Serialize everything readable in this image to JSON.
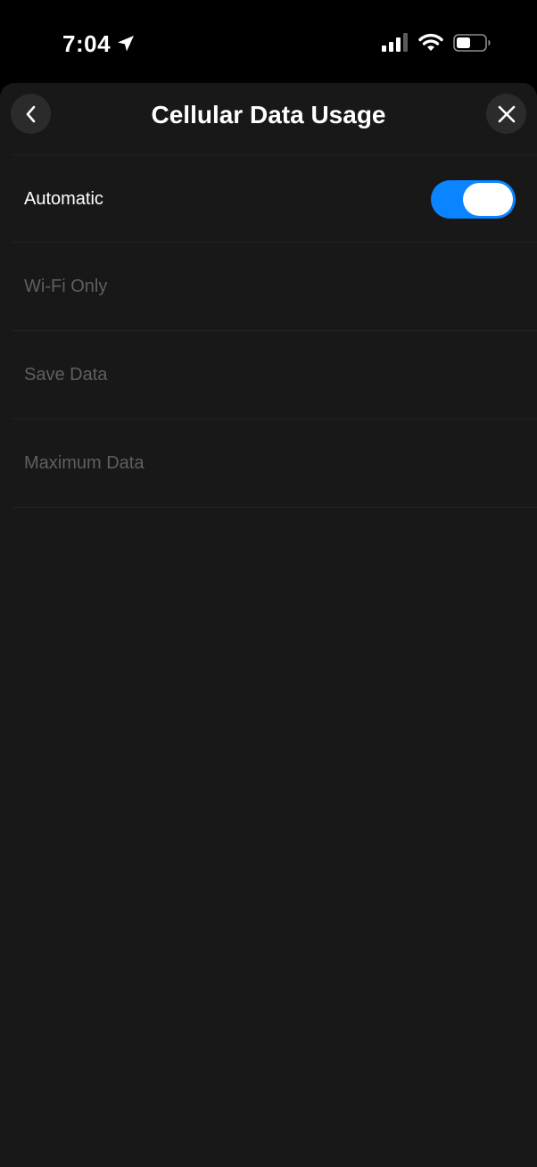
{
  "status_bar": {
    "time": "7:04",
    "icons": [
      "location-arrow-icon",
      "cellular-signal-icon",
      "wifi-icon",
      "battery-icon"
    ]
  },
  "header": {
    "title": "Cellular Data Usage",
    "back_icon": "chevron-left-icon",
    "close_icon": "close-icon"
  },
  "options": [
    {
      "label": "Automatic",
      "toggle_on": true
    },
    {
      "label": "Wi-Fi Only"
    },
    {
      "label": "Save Data"
    },
    {
      "label": "Maximum Data"
    }
  ],
  "colors": {
    "background": "#181818",
    "toggle_on": "#0a84ff",
    "disabled_text": "#5f5f5f"
  }
}
